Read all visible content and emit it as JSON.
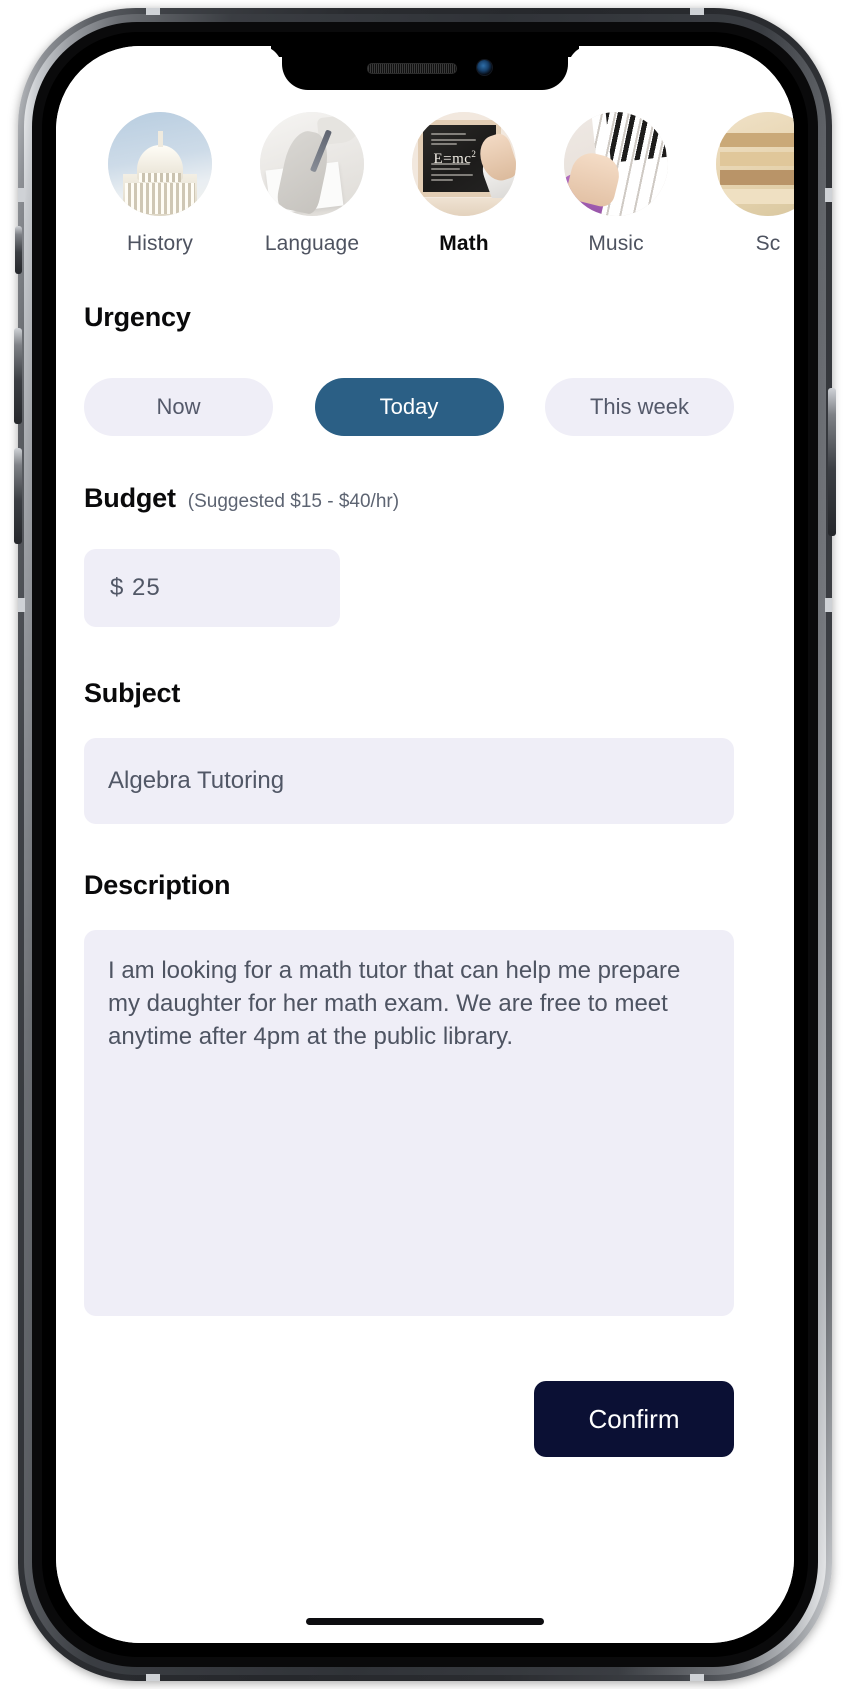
{
  "device": {
    "notch": {
      "speaker_icon": "speaker-grille-icon",
      "camera_icon": "front-camera-icon"
    },
    "home_indicator": "home-indicator"
  },
  "categories": {
    "items": [
      {
        "label": "History",
        "icon": "capitol-dome-thumbnail",
        "selected": false
      },
      {
        "label": "Language",
        "icon": "writing-hand-thumbnail",
        "selected": false
      },
      {
        "label": "Math",
        "icon": "blackboard-emc2-thumbnail",
        "selected": true
      },
      {
        "label": "Music",
        "icon": "piano-keys-thumbnail",
        "selected": false
      },
      {
        "label": "Sc",
        "icon": "science-books-thumbnail",
        "selected": false
      }
    ]
  },
  "urgency": {
    "heading": "Urgency",
    "options": [
      {
        "label": "Now",
        "selected": false
      },
      {
        "label": "Today",
        "selected": true
      },
      {
        "label": "This week",
        "selected": false
      }
    ]
  },
  "budget": {
    "heading": "Budget",
    "suggestion": "(Suggested $15 - $40/hr)",
    "value": "$ 25"
  },
  "subject": {
    "heading": "Subject",
    "value": "Algebra Tutoring"
  },
  "description": {
    "heading": "Description",
    "value": "I am looking for a math tutor that can help me prepare my daughter for her math exam. We are free to meet anytime after 4pm at the public library."
  },
  "actions": {
    "confirm_label": "Confirm"
  },
  "colors": {
    "accent_selected_pill": "#2b5f85",
    "field_background": "#efeef7",
    "confirm_background": "#0b1034",
    "heading_text": "#0a0a0b",
    "body_text": "#4e5462"
  }
}
